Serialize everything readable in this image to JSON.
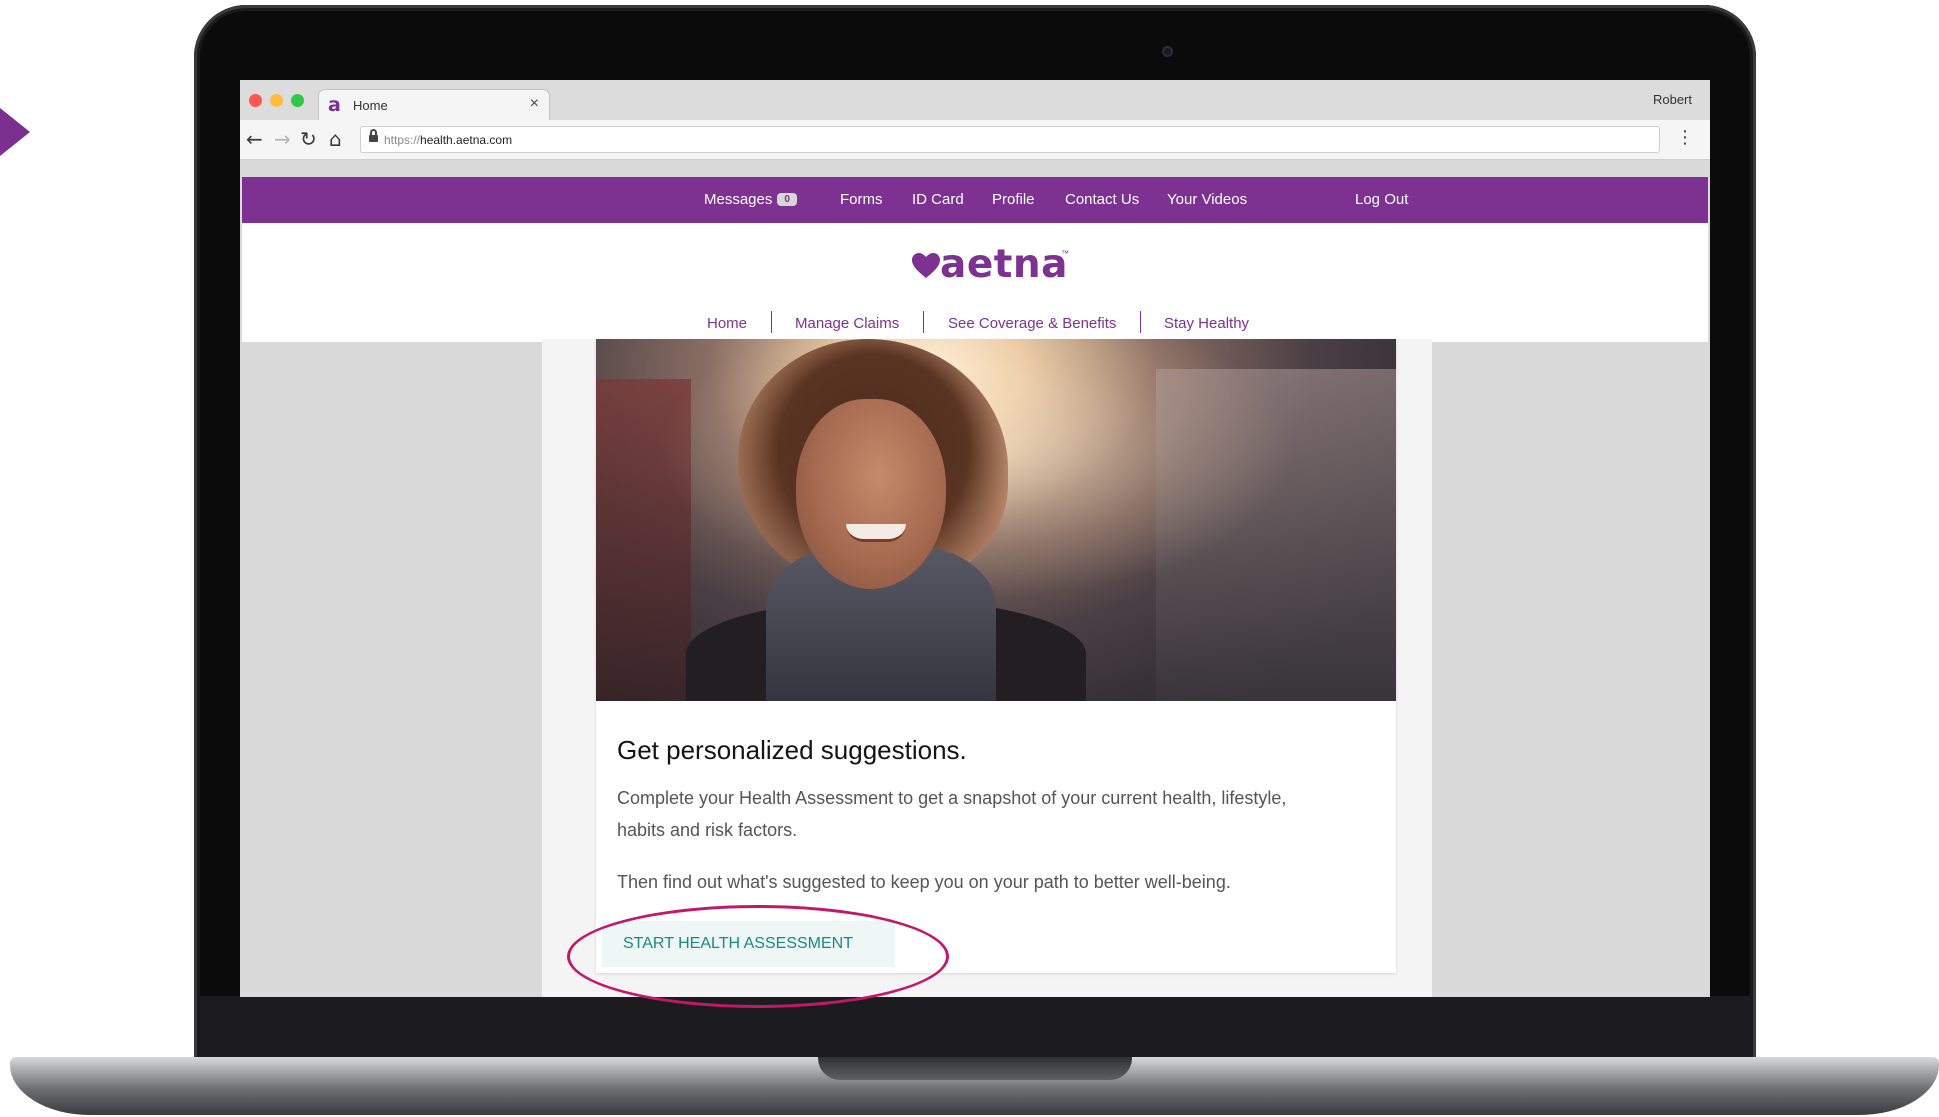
{
  "browser": {
    "tab_title": "Home",
    "tab_close": "×",
    "favicon": "a",
    "profile_name": "Robert",
    "url_scheme": "https://",
    "url_host": "health.aetna.com",
    "icons": [
      "back-icon",
      "forward-icon",
      "reload-icon",
      "home-icon",
      "lock-icon",
      "menu-icon",
      "close-icon"
    ]
  },
  "topnav": {
    "messages_label": "Messages",
    "messages_count": "0",
    "items": [
      "Forms",
      "ID Card",
      "Profile",
      "Contact Us",
      "Your Videos",
      "Log Out"
    ]
  },
  "header": {
    "logo_text": "aetna",
    "logo_tm": "™",
    "subnav": [
      "Home",
      "Manage Claims",
      "See Coverage & Benefits",
      "Stay Healthy"
    ]
  },
  "card": {
    "title": "Get personalized suggestions.",
    "body1": "Complete your Health Assessment to get a snapshot of your current health, lifestyle, habits and risk factors.",
    "body2": "Then find out what's suggested to keep you on your path to better well-being.",
    "cta_label": "START HEALTH ASSESSMENT"
  },
  "colors": {
    "brand_purple": "#7d3191",
    "cta_text": "#1a8a7a",
    "highlight_ring": "#c2186b"
  }
}
